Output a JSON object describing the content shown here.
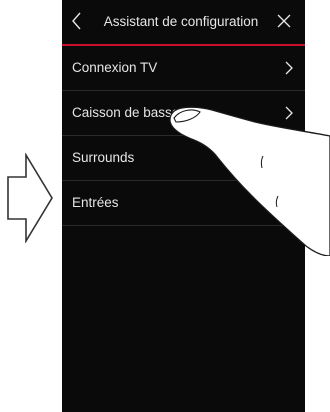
{
  "header": {
    "title": "Assistant de configuration",
    "back_icon": "chevron-left-icon",
    "close_icon": "close-icon"
  },
  "menu": {
    "items": [
      {
        "label": "Connexion TV",
        "chevron": true
      },
      {
        "label": "Caisson de basse",
        "chevron": true
      },
      {
        "label": "Surrounds",
        "chevron": false
      },
      {
        "label": "Entrées",
        "chevron": false
      }
    ]
  },
  "colors": {
    "screen_bg": "#0a0a0a",
    "accent": "#c8102e",
    "text": "#e6e6e6",
    "divider": "#2a2a2a"
  },
  "decor": {
    "side_arrow_icon": "arrow-right-outline-icon",
    "hand_icon": "pointing-hand-icon"
  }
}
